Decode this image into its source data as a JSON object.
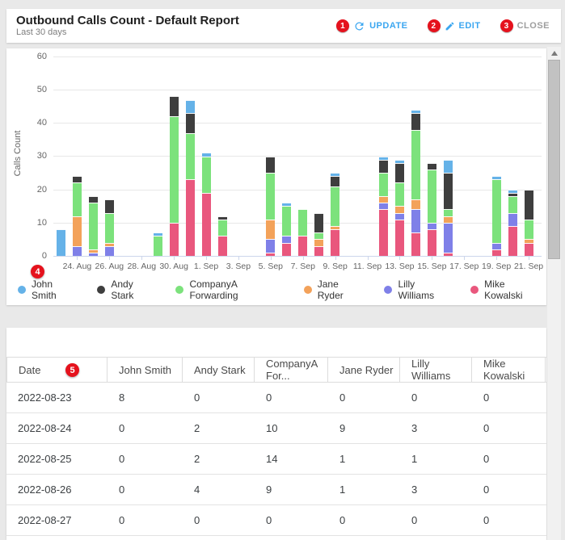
{
  "header": {
    "title": "Outbound Calls Count - Default Report",
    "subtitle": "Last 30 days",
    "accent_color": "#3aa6f0",
    "badge_color": "#e5121d",
    "actions": [
      {
        "badge": "1",
        "label": "UPDATE",
        "icon": "refresh-icon",
        "color": "#3aa6f0"
      },
      {
        "badge": "2",
        "label": "EDIT",
        "icon": "pencil-icon",
        "color": "#3aa6f0"
      },
      {
        "badge": "3",
        "label": "CLOSE",
        "icon": "",
        "color": "#9e9e9e"
      }
    ]
  },
  "annotations": {
    "chart_badge": "4",
    "table_badge": "5"
  },
  "chart": {
    "ylabel": "Calls Count",
    "yticks": [
      0,
      10,
      20,
      30,
      40,
      50,
      60
    ],
    "xtick_labels": [
      "24. Aug",
      "26. Aug",
      "28. Aug",
      "30. Aug",
      "1. Sep",
      "3. Sep",
      "5. Sep",
      "7. Sep",
      "9. Sep",
      "11. Sep",
      "13. Sep",
      "15. Sep",
      "17. Sep",
      "19. Sep",
      "21. Sep"
    ]
  },
  "chart_data": {
    "type": "bar",
    "stacked": true,
    "title": "",
    "xlabel": "",
    "ylabel": "Calls Count",
    "ylim": [
      0,
      60
    ],
    "grid": true,
    "legend_position": "bottom",
    "stack_order_bottom_to_top": [
      "Mike Kowalski",
      "Lilly Williams",
      "Jane Ryder",
      "CompanyA Forwarding",
      "Andy Stark",
      "John Smith"
    ],
    "categories": [
      "2022-08-23",
      "2022-08-24",
      "2022-08-25",
      "2022-08-26",
      "2022-08-27",
      "2022-08-28",
      "2022-08-29",
      "2022-08-30",
      "2022-08-31",
      "2022-09-01",
      "2022-09-02",
      "2022-09-03",
      "2022-09-04",
      "2022-09-05",
      "2022-09-06",
      "2022-09-07",
      "2022-09-08",
      "2022-09-09",
      "2022-09-10",
      "2022-09-11",
      "2022-09-12",
      "2022-09-13",
      "2022-09-14",
      "2022-09-15",
      "2022-09-16",
      "2022-09-17",
      "2022-09-18",
      "2022-09-19",
      "2022-09-20",
      "2022-09-21"
    ],
    "series": [
      {
        "name": "John Smith",
        "color": "#65b2e8",
        "values": [
          8,
          0,
          0,
          0,
          0,
          0,
          1,
          0,
          4,
          1,
          0,
          0,
          0,
          0,
          1,
          0,
          0,
          1,
          0,
          0,
          1,
          1,
          1,
          0,
          4,
          0,
          0,
          1,
          1,
          0
        ]
      },
      {
        "name": "Andy Stark",
        "color": "#3e3e3e",
        "values": [
          0,
          2,
          2,
          4,
          0,
          0,
          0,
          6,
          6,
          0,
          1,
          0,
          0,
          5,
          0,
          0,
          6,
          3,
          0,
          0,
          4,
          6,
          5,
          2,
          11,
          0,
          0,
          0,
          1,
          9
        ]
      },
      {
        "name": "CompanyA Forwarding",
        "color": "#7ce27c",
        "values": [
          0,
          10,
          14,
          9,
          0,
          0,
          6,
          32,
          14,
          11,
          5,
          0,
          0,
          14,
          9,
          8,
          2,
          12,
          0,
          0,
          7,
          7,
          21,
          16,
          2,
          0,
          0,
          19,
          5,
          6
        ]
      },
      {
        "name": "Jane Ryder",
        "color": "#f3a25a",
        "values": [
          0,
          9,
          1,
          1,
          0,
          0,
          0,
          0,
          0,
          0,
          0,
          0,
          0,
          6,
          0,
          0,
          2,
          1,
          0,
          0,
          2,
          2,
          3,
          0,
          2,
          0,
          0,
          0,
          0,
          1
        ]
      },
      {
        "name": "Lilly Williams",
        "color": "#7f80e8",
        "values": [
          0,
          3,
          1,
          3,
          0,
          0,
          0,
          0,
          0,
          0,
          0,
          0,
          0,
          4,
          2,
          0,
          0,
          0,
          0,
          0,
          2,
          2,
          7,
          2,
          9,
          0,
          0,
          2,
          4,
          0
        ]
      },
      {
        "name": "Mike Kowalski",
        "color": "#e9577d",
        "values": [
          0,
          0,
          0,
          0,
          0,
          0,
          0,
          10,
          23,
          19,
          6,
          0,
          0,
          1,
          4,
          6,
          3,
          8,
          0,
          0,
          14,
          11,
          7,
          8,
          1,
          0,
          0,
          2,
          9,
          4
        ]
      }
    ]
  },
  "table": {
    "columns": [
      "Date",
      "John Smith",
      "Andy Stark",
      "CompanyA For...",
      "Jane Ryder",
      "Lilly Williams",
      "Mike Kowalski"
    ],
    "rows": [
      {
        "date": "2022-08-23",
        "values": [
          "8",
          "0",
          "0",
          "0",
          "0",
          "0"
        ]
      },
      {
        "date": "2022-08-24",
        "values": [
          "0",
          "2",
          "10",
          "9",
          "3",
          "0"
        ]
      },
      {
        "date": "2022-08-25",
        "values": [
          "0",
          "2",
          "14",
          "1",
          "1",
          "0"
        ]
      },
      {
        "date": "2022-08-26",
        "values": [
          "0",
          "4",
          "9",
          "1",
          "3",
          "0"
        ]
      },
      {
        "date": "2022-08-27",
        "values": [
          "0",
          "0",
          "0",
          "0",
          "0",
          "0"
        ]
      }
    ]
  }
}
